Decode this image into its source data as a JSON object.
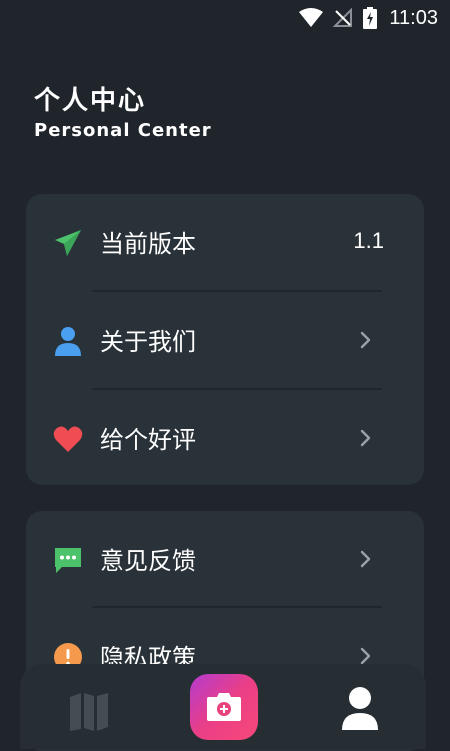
{
  "status_bar": {
    "time": "11:03",
    "icons": [
      "wifi-icon",
      "no-signal-icon",
      "battery-charging-icon"
    ]
  },
  "header": {
    "title": "个人中心",
    "subtitle": "Personal Center"
  },
  "card_1": {
    "items": [
      {
        "label": "当前版本",
        "value": "1.1",
        "icon": "paper-plane-icon"
      },
      {
        "label": "关于我们",
        "icon": "person-icon"
      },
      {
        "label": "给个好评",
        "icon": "heart-icon"
      }
    ]
  },
  "card_2": {
    "items": [
      {
        "label": "意见反馈",
        "icon": "chat-bubble-icon"
      },
      {
        "label": "隐私政策",
        "icon": "alert-icon"
      }
    ]
  },
  "bottom_nav": {
    "items": [
      "map-icon",
      "camera-icon",
      "profile-icon"
    ],
    "active": "profile-icon"
  },
  "colors": {
    "background": "#1f252b",
    "card": "#293238",
    "accent_green": "#4cc26b",
    "accent_blue": "#4a9ff0",
    "accent_red": "#ef4c53",
    "accent_orange": "#f59a4d",
    "camera_gradient": [
      "#b33bd0",
      "#f7487a"
    ]
  }
}
